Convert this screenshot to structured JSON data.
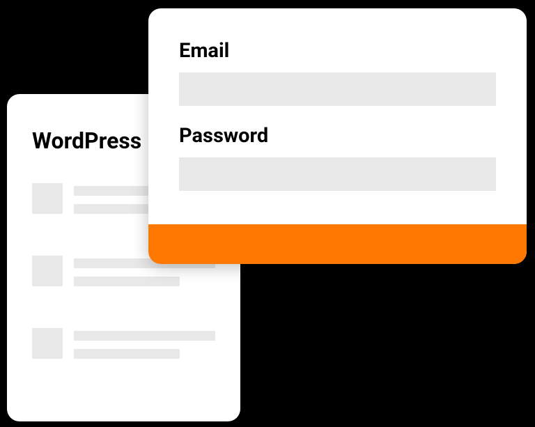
{
  "wordpress_card": {
    "title": "WordPress"
  },
  "login_card": {
    "email_label": "Email",
    "password_label": "Password",
    "accent_color": "#ff7800"
  }
}
